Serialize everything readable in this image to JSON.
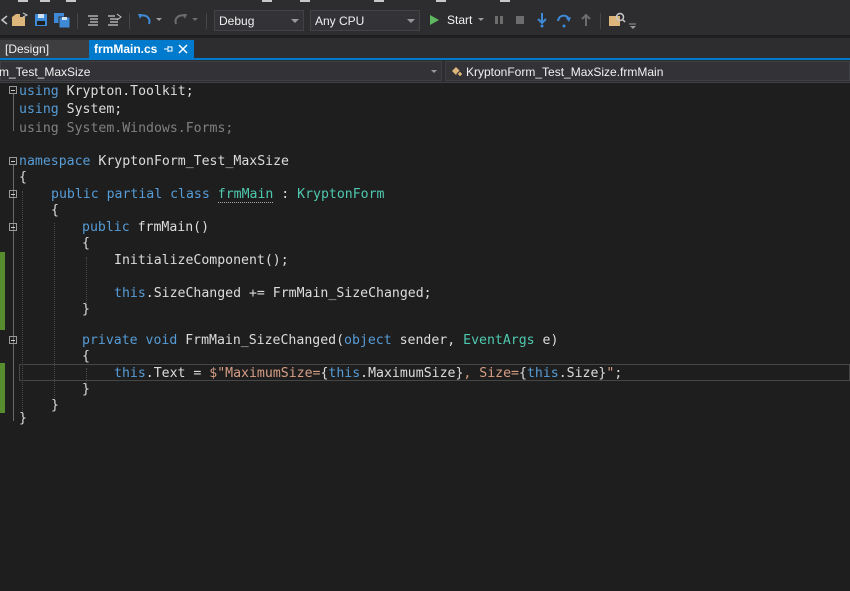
{
  "toolbar": {
    "configuration": "Debug",
    "platform": "Any CPU",
    "start_label": "Start"
  },
  "tabs": [
    {
      "label": "[Design]"
    },
    {
      "label": "frmMain.cs"
    }
  ],
  "navbar": {
    "project": "m_Test_MaxSize",
    "type": "KryptonForm_Test_MaxSize.frmMain"
  },
  "code": {
    "l1": {
      "kw": "using",
      "rest": " Krypton.Toolkit;"
    },
    "l2": {
      "kw": "using",
      "rest": " System;"
    },
    "l3": {
      "kw": "using",
      "rest": " System.Windows.Forms;"
    },
    "l4": {
      "kw": "namespace",
      "rest": " KryptonForm_Test_MaxSize"
    },
    "l5": "{",
    "l6": {
      "kw": "public partial class",
      "name": "frmMain",
      "sep": " : ",
      "base": "KryptonForm"
    },
    "l7": "{",
    "l8": {
      "kw": "public",
      "rest": " frmMain()"
    },
    "l9": "{",
    "l10": "InitializeComponent();",
    "l11": {
      "kw": "this",
      "rest": ".SizeChanged += FrmMain_SizeChanged;"
    },
    "l12": "}",
    "l13": {
      "kw": "private void",
      "name": " FrmMain_SizeChanged(",
      "p1": "object",
      "p2": " sender, ",
      "p3": "EventArgs",
      "p4": " e)"
    },
    "l14": "{",
    "l15": {
      "kw": "this",
      "a": ".Text = ",
      "s1": "$\"MaximumSize=",
      "b1": "{",
      "k2": "this",
      "a2": ".MaximumSize",
      "b2": "}",
      "s2": ", Size=",
      "b3": "{",
      "k3": "this",
      "a3": ".Size",
      "b4": "}",
      "s3": "\"",
      "end": ";"
    },
    "l16": "}",
    "l17": "}",
    "l18": "}"
  }
}
